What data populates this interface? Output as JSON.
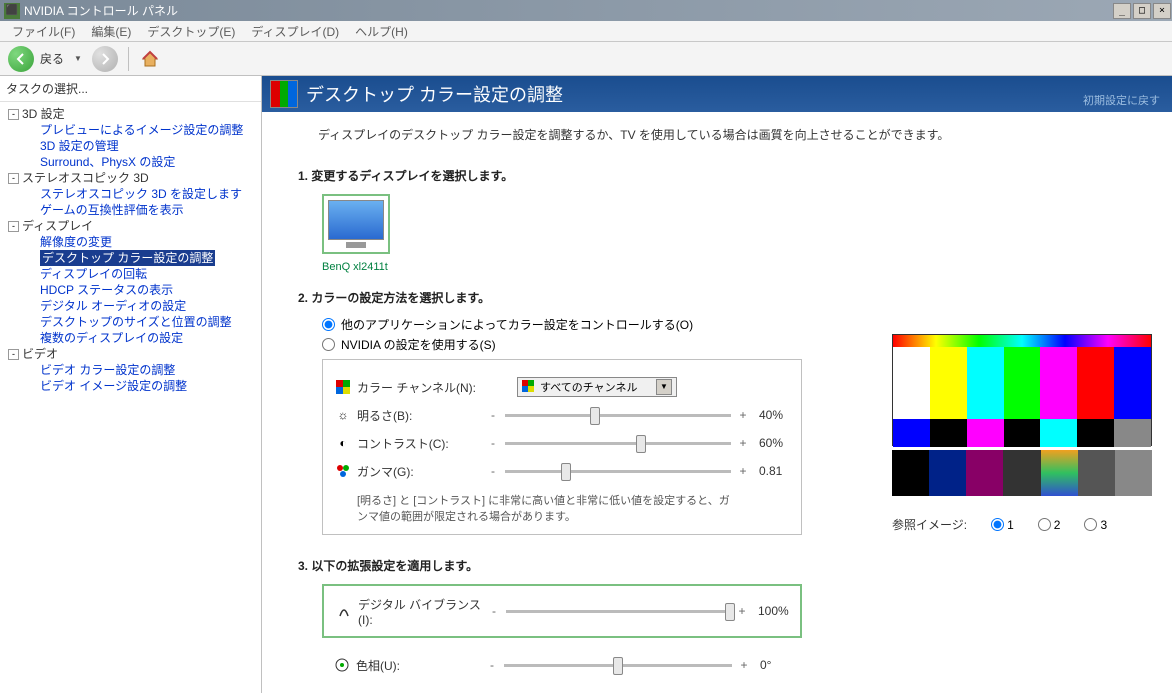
{
  "window": {
    "title": "NVIDIA コントロール パネル"
  },
  "menu": {
    "file": "ファイル(F)",
    "edit": "編集(E)",
    "desktop": "デスクトップ(E)",
    "display": "ディスプレイ(D)",
    "help": "ヘルプ(H)"
  },
  "toolbar": {
    "back": "戻る"
  },
  "sidebar": {
    "header": "タスクの選択...",
    "group_3d": "3D 設定",
    "preview_adjust": "プレビューによるイメージ設定の調整",
    "manage_3d": "3D 設定の管理",
    "surround": "Surround、PhysX の設定",
    "group_stereo": "ステレオスコピック 3D",
    "stereo_setup": "ステレオスコピック 3D を設定します",
    "compat": "ゲームの互換性評価を表示",
    "group_display": "ディスプレイ",
    "resolution": "解像度の変更",
    "desktop_color": "デスクトップ カラー設定の調整",
    "rotation": "ディスプレイの回転",
    "hdcp": "HDCP ステータスの表示",
    "digital_audio": "デジタル オーディオの設定",
    "size_position": "デスクトップのサイズと位置の調整",
    "multi_display": "複数のディスプレイの設定",
    "group_video": "ビデオ",
    "video_color": "ビデオ カラー設定の調整",
    "video_image": "ビデオ イメージ設定の調整"
  },
  "header": {
    "title": "デスクトップ カラー設定の調整",
    "reset": "初期設定に戻す"
  },
  "desc": "ディスプレイのデスクトップ カラー設定を調整するか、TV を使用している場合は画質を向上させることができます。",
  "section1": {
    "title": "1. 変更するディスプレイを選択します。",
    "display_name": "BenQ xl2411t"
  },
  "section2": {
    "title": "2. カラーの設定方法を選択します。",
    "radio_other": "他のアプリケーションによってカラー設定をコントロールする(O)",
    "radio_nvidia": "NVIDIA の設定を使用する(S)",
    "channel_label": "カラー チャンネル(N):",
    "channel_value": "すべてのチャンネル",
    "brightness_label": "明るさ(B):",
    "brightness_value": "40%",
    "contrast_label": "コントラスト(C):",
    "contrast_value": "60%",
    "gamma_label": "ガンマ(G):",
    "gamma_value": "0.81",
    "note": "[明るさ] と [コントラスト] に非常に高い値と非常に低い値を設定すると、ガンマ値の範囲が限定される場合があります。"
  },
  "section3": {
    "title": "3. 以下の拡張設定を適用します。",
    "vibrance_label": "デジタル バイブランス(I):",
    "vibrance_value": "100%",
    "hue_label": "色相(U):",
    "hue_value": "0°"
  },
  "preview": {
    "label": "参照イメージ:",
    "r1": "1",
    "r2": "2",
    "r3": "3"
  },
  "chart_data": {
    "type": "sliders",
    "items": [
      {
        "name": "brightness",
        "value": 40,
        "unit": "%",
        "min": 0,
        "max": 100
      },
      {
        "name": "contrast",
        "value": 60,
        "unit": "%",
        "min": 0,
        "max": 100
      },
      {
        "name": "gamma",
        "value": 0.81,
        "min": 0,
        "max": 3
      },
      {
        "name": "digital_vibrance",
        "value": 100,
        "unit": "%",
        "min": 0,
        "max": 100
      },
      {
        "name": "hue",
        "value": 0,
        "unit": "°",
        "min": -180,
        "max": 180
      }
    ]
  }
}
